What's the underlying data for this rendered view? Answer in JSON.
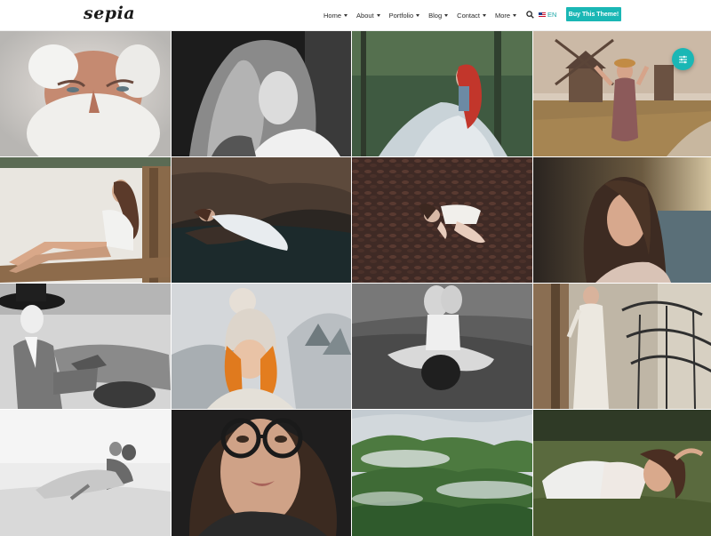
{
  "header": {
    "logo": "sepia",
    "nav": [
      {
        "label": "Home"
      },
      {
        "label": "About"
      },
      {
        "label": "Portfolio"
      },
      {
        "label": "Blog"
      },
      {
        "label": "Contact"
      },
      {
        "label": "More"
      }
    ],
    "language": "EN",
    "cta_label": "Buy This Theme!"
  },
  "colors": {
    "accent": "#1ab7b5"
  },
  "gallery": [
    {
      "subject": "old-man-portrait"
    },
    {
      "subject": "woman-bw-portrait"
    },
    {
      "subject": "redhead-in-forest"
    },
    {
      "subject": "woman-near-windmill"
    },
    {
      "subject": "woman-on-pier"
    },
    {
      "subject": "woman-in-river"
    },
    {
      "subject": "woman-on-leaves"
    },
    {
      "subject": "woman-at-sunset"
    },
    {
      "subject": "woman-with-hat-bw"
    },
    {
      "subject": "woman-in-knit-hat"
    },
    {
      "subject": "woman-in-water-bw"
    },
    {
      "subject": "woman-in-lace-dress"
    },
    {
      "subject": "couple-on-beach"
    },
    {
      "subject": "woman-with-glasses"
    },
    {
      "subject": "misty-forest"
    },
    {
      "subject": "woman-in-grass"
    }
  ]
}
